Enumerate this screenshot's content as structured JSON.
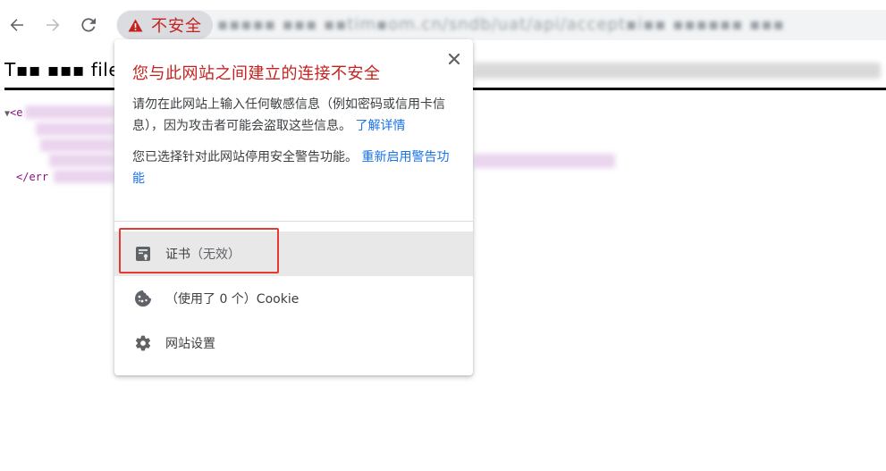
{
  "toolbar": {
    "security_chip_label": "不安全",
    "url": "▪▪▪▪▪ ▪▪▪ ▪▪tim▪om.cn/sndb/uat/api/accept▪i▪▪ ▪▪▪▪▪▪ ▪▪▪"
  },
  "page": {
    "heading": "T▪▪ ▪▪▪ file"
  },
  "popup": {
    "title": "您与此网站之间建立的连接不安全",
    "paragraph1_text": "请勿在此网站上输入任何敏感信息（例如密码或信用卡信息），因为攻击者可能会盗取这些信息。",
    "paragraph1_link": "了解详情",
    "paragraph2_text": "您已选择针对此网站停用安全警告功能。",
    "paragraph2_link": "重新启用警告功能",
    "certificate_label": "证书",
    "certificate_status": "（无效）",
    "cookies_label": "（使用了 0 个）Cookie",
    "site_settings_label": "网站设置"
  },
  "colors": {
    "danger": "#c5221f",
    "link": "#1a73e8",
    "annotation": "#e53935"
  },
  "icons": {
    "back": "arrow-left-icon",
    "forward": "arrow-right-icon",
    "reload": "reload-icon",
    "warning": "warning-triangle-icon",
    "close": "close-icon",
    "certificate": "certificate-icon",
    "cookie": "cookie-icon",
    "settings": "gear-icon"
  }
}
